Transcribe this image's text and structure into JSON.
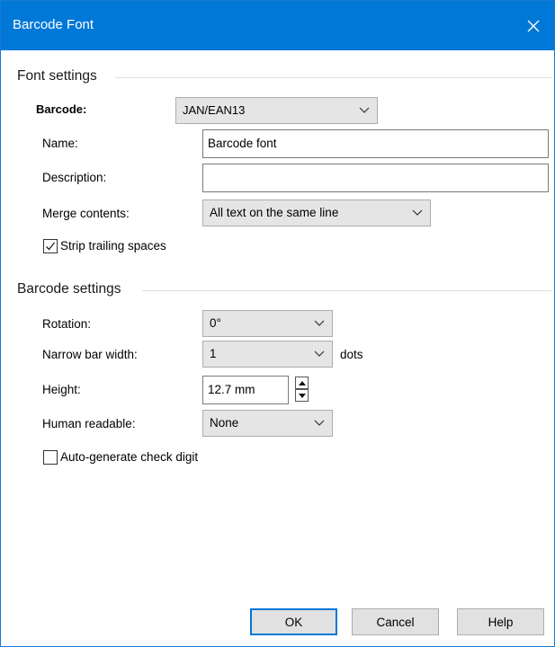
{
  "window": {
    "title": "Barcode Font"
  },
  "font_settings": {
    "group_title": "Font settings",
    "barcode_label": "Barcode:",
    "barcode_value": "JAN/EAN13",
    "name_label": "Name:",
    "name_value": "Barcode font",
    "description_label": "Description:",
    "description_value": "",
    "merge_label": "Merge contents:",
    "merge_value": "All text on the same line",
    "strip_label": "Strip trailing spaces",
    "strip_checked": true
  },
  "barcode_settings": {
    "group_title": "Barcode settings",
    "rotation_label": "Rotation:",
    "rotation_value": "0°",
    "narrow_label": "Narrow bar width:",
    "narrow_value": "1",
    "narrow_unit": "dots",
    "height_label": "Height:",
    "height_value": "12.7 mm",
    "human_label": "Human readable:",
    "human_value": "None",
    "autocheck_label": "Auto-generate check digit",
    "autocheck_checked": false
  },
  "buttons": {
    "ok": "OK",
    "cancel": "Cancel",
    "help": "Help"
  },
  "colors": {
    "titlebar": "#0078d7",
    "combo_bg": "#e5e5e5",
    "button_bg": "#e1e1e1"
  }
}
